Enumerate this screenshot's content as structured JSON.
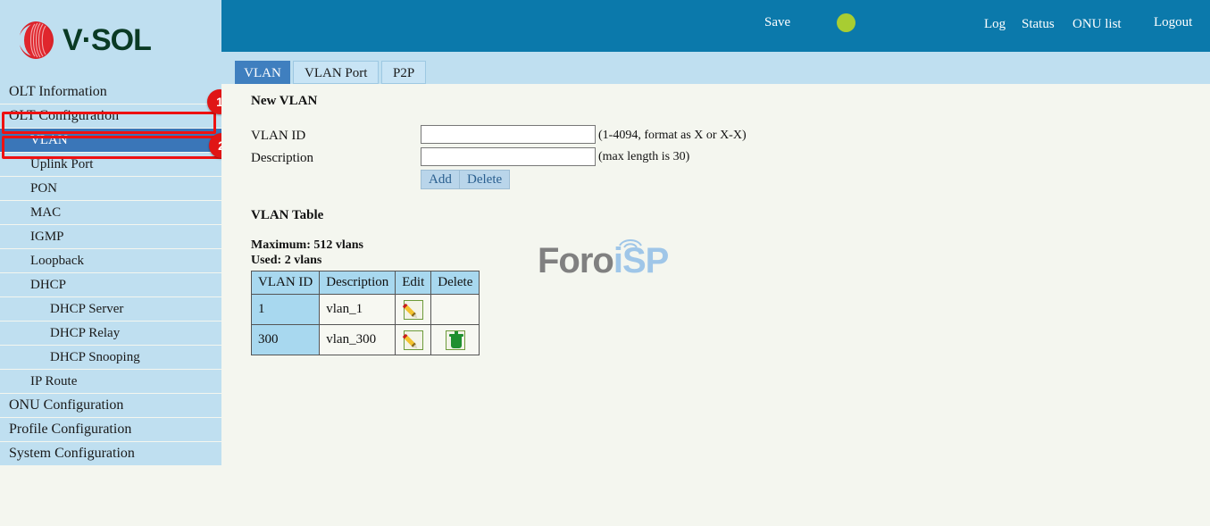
{
  "brand": {
    "logo_text": "V·SOL",
    "logo_icon": "vsol-leaf-logo"
  },
  "header": {
    "save_label": "Save",
    "status_indicator": "green-status-dot",
    "status_color": "#a8cd32",
    "links": [
      {
        "label": "Log"
      },
      {
        "label": "Status"
      },
      {
        "label": "ONU list"
      },
      {
        "label": "Logout"
      }
    ]
  },
  "tabs": [
    {
      "label": "VLAN",
      "active": true
    },
    {
      "label": "VLAN Port",
      "active": false
    },
    {
      "label": "P2P",
      "active": false
    }
  ],
  "sidebar": {
    "items": [
      {
        "label": "OLT Information",
        "level": 1,
        "selected": false
      },
      {
        "label": "OLT Configuration",
        "level": 1,
        "selected": false
      },
      {
        "label": "VLAN",
        "level": 2,
        "selected": true
      },
      {
        "label": "Uplink Port",
        "level": 2,
        "selected": false
      },
      {
        "label": "PON",
        "level": 2,
        "selected": false
      },
      {
        "label": "MAC",
        "level": 2,
        "selected": false
      },
      {
        "label": "IGMP",
        "level": 2,
        "selected": false
      },
      {
        "label": "Loopback",
        "level": 2,
        "selected": false
      },
      {
        "label": "DHCP",
        "level": 2,
        "selected": false
      },
      {
        "label": "DHCP Server",
        "level": 3,
        "selected": false
      },
      {
        "label": "DHCP Relay",
        "level": 3,
        "selected": false
      },
      {
        "label": "DHCP Snooping",
        "level": 3,
        "selected": false
      },
      {
        "label": "IP Route",
        "level": 2,
        "selected": false
      },
      {
        "label": "ONU Configuration",
        "level": 1,
        "selected": false
      },
      {
        "label": "Profile Configuration",
        "level": 1,
        "selected": false
      },
      {
        "label": "System Configuration",
        "level": 1,
        "selected": false
      }
    ]
  },
  "annotations": {
    "color": "#ee1111",
    "steps": [
      {
        "number": "1",
        "target": "OLT Configuration"
      },
      {
        "number": "2",
        "target": "VLAN"
      }
    ]
  },
  "main": {
    "new_vlan": {
      "title": "New VLAN",
      "vlan_id_label": "VLAN ID",
      "vlan_id_value": "",
      "vlan_id_hint": "(1-4094, format as X or X-X)",
      "description_label": "Description",
      "description_value": "",
      "description_hint": "(max length is 30)",
      "add_label": "Add",
      "delete_label": "Delete"
    },
    "vlan_table": {
      "title": "VLAN Table",
      "maximum_text": "Maximum: 512 vlans",
      "used_text": "Used: 2 vlans",
      "columns": [
        "VLAN ID",
        "Description",
        "Edit",
        "Delete"
      ],
      "rows": [
        {
          "vlan_id": "1",
          "description": "vlan_1",
          "edit_icon": "pencil-edit-icon",
          "delete_icon": ""
        },
        {
          "vlan_id": "300",
          "description": "vlan_300",
          "edit_icon": "pencil-edit-icon",
          "delete_icon": "trash-delete-icon"
        }
      ]
    }
  },
  "watermark": {
    "part1": "Foro",
    "part2": "iSP"
  }
}
